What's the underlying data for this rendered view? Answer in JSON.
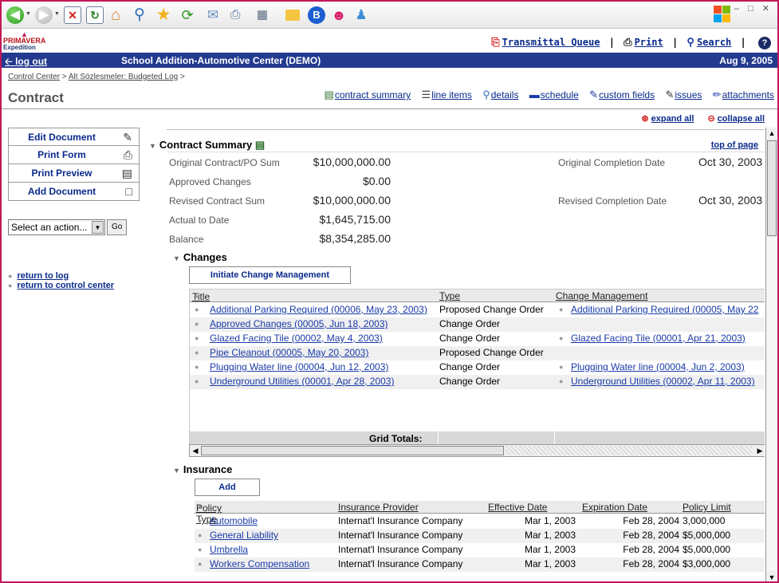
{
  "header": {
    "transmittal_label": "Transmittal Queue",
    "print_label": "Print",
    "search_label": "Search",
    "help_glyph": "?"
  },
  "bluebar": {
    "logout_label": "log out",
    "project": "School Addition-Automotive Center (DEMO)",
    "date": "Aug 9, 2005"
  },
  "breadcrumb": {
    "part1": "Control Center",
    "sep": " > ",
    "part2": "Alt Sözlesmeler: Budgeted Log",
    "sep2": " >"
  },
  "page_title": "Contract",
  "tabs": [
    {
      "label": "contract summary",
      "icon": "summary-icon"
    },
    {
      "label": "line items",
      "icon": "line-items-icon"
    },
    {
      "label": "details",
      "icon": "details-icon"
    },
    {
      "label": "schedule",
      "icon": "schedule-icon"
    },
    {
      "label": "custom fields",
      "icon": "custom-fields-icon"
    },
    {
      "label": "issues",
      "icon": "issues-icon"
    },
    {
      "label": "attachments",
      "icon": "attachments-icon"
    }
  ],
  "left_actions": [
    {
      "label": "Edit Document"
    },
    {
      "label": "Print Form"
    },
    {
      "label": "Print Preview"
    },
    {
      "label": "Add Document"
    }
  ],
  "action_select": {
    "value": "Select an action...",
    "go": "Go"
  },
  "return_links": {
    "log": "return to log",
    "control_center": "return to control center"
  },
  "expand": {
    "expand_all": "expand all",
    "collapse_all": "collapse all"
  },
  "contract_summary": {
    "title": "Contract Summary",
    "top_of_page": "top of page",
    "rows": [
      {
        "label": "Original Contract/PO Sum",
        "value": "$10,000,000.00"
      },
      {
        "label": "Approved Changes",
        "value": "$0.00"
      },
      {
        "label": "Revised Contract Sum",
        "value": "$10,000,000.00"
      },
      {
        "label": "Actual to Date",
        "value": "$1,645,715.00"
      },
      {
        "label": "Balance",
        "value": "$8,354,285.00"
      }
    ],
    "dates": [
      {
        "label": "Original Completion Date",
        "value": "Oct 30, 2003"
      },
      {
        "label": "Revised Completion Date",
        "value": "Oct 30, 2003"
      }
    ]
  },
  "changes": {
    "title": "Changes",
    "initiate_label": "Initiate Change Management",
    "columns": [
      "Title",
      "Type",
      "Change Management"
    ],
    "rows": [
      {
        "title": "Additional Parking Required (00006, May 23, 2003)",
        "type": "Proposed Change Order",
        "cm": "Additional Parking Required (00005, May 22"
      },
      {
        "title": "Approved Changes (00005, Jun 18, 2003)",
        "type": "Change Order",
        "cm": ""
      },
      {
        "title": "Glazed Facing Tile (00002, May 4, 2003)",
        "type": "Change Order",
        "cm": "Glazed Facing Tile (00001, Apr 21, 2003)"
      },
      {
        "title": "Pipe Cleanout (00005, May 20, 2003)",
        "type": "Proposed Change Order",
        "cm": ""
      },
      {
        "title": "Plugging Water line (00004, Jun 12, 2003)",
        "type": "Change Order",
        "cm": "Plugging Water line (00004, Jun 2, 2003)"
      },
      {
        "title": "Underground Utilities (00001, Apr 28, 2003)",
        "type": "Change Order",
        "cm": "Underground Utilities (00002, Apr 11, 2003)"
      }
    ],
    "totals_label": "Grid Totals:"
  },
  "insurance": {
    "title": "Insurance",
    "add_label": "Add",
    "columns": [
      "Policy Type",
      "Insurance Provider",
      "Effective Date",
      "Expiration Date",
      "Policy Limit"
    ],
    "rows": [
      {
        "type": "Automobile",
        "provider": "Internat'l Insurance Company",
        "effective": "Mar 1, 2003",
        "expiration": "Feb 28, 2004",
        "limit": "3,000,000"
      },
      {
        "type": "General Liability",
        "provider": "Internat'l Insurance Company",
        "effective": "Mar 1, 2003",
        "expiration": "Feb 28, 2004",
        "limit": "$5,000,000"
      },
      {
        "type": "Umbrella",
        "provider": "Internat'l Insurance Company",
        "effective": "Mar 1, 2003",
        "expiration": "Feb 28, 2004",
        "limit": "$5,000,000"
      },
      {
        "type": "Workers Compensation",
        "provider": "Internat'l Insurance Company",
        "effective": "Mar 1, 2003",
        "expiration": "Feb 28, 2004",
        "limit": "$3,000,000"
      }
    ]
  },
  "colors": {
    "brand_blue": "#233a8f",
    "link_blue": "#0a2a8c",
    "frame": "#c21859"
  }
}
